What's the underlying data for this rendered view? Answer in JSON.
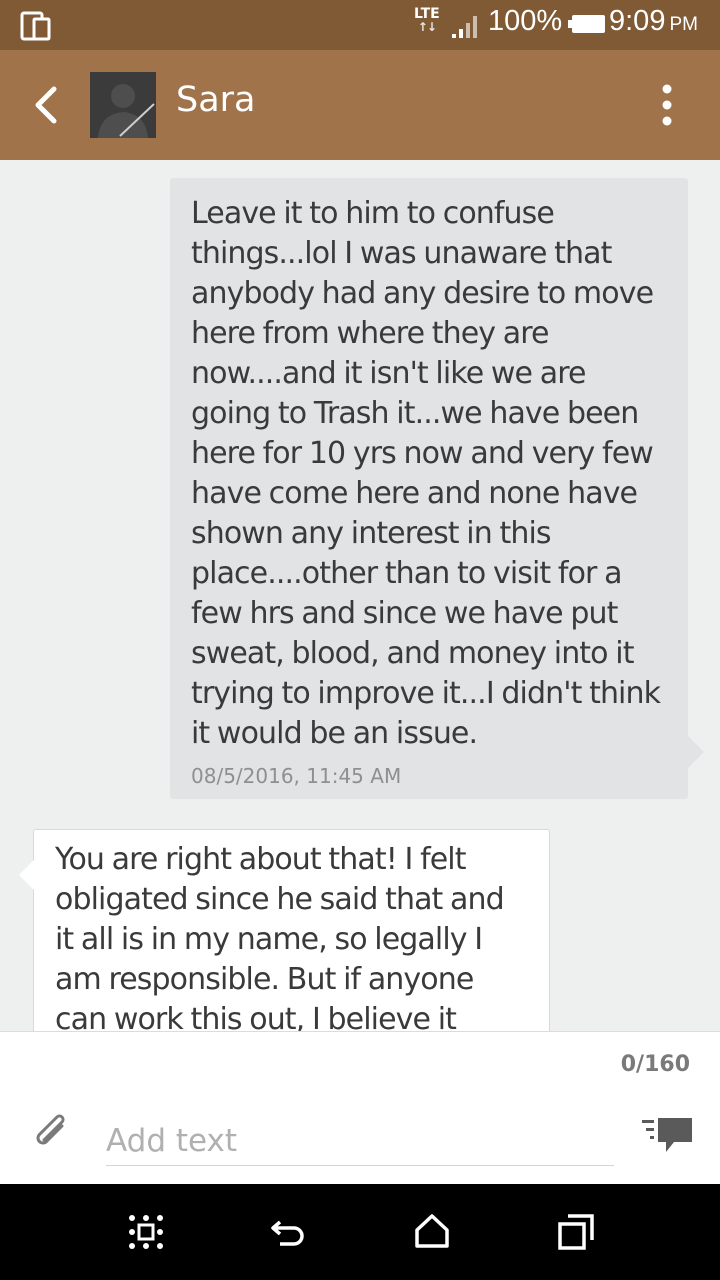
{
  "status_bar": {
    "network": "LTE",
    "battery": "100%",
    "time": "9:09",
    "ampm": "PM"
  },
  "header": {
    "contact_name": "Sara"
  },
  "messages": [
    {
      "direction": "outgoing",
      "text": "Leave it to him to confuse things...lol I was unaware that anybody had any desire to move here from where they are now....and it isn't like we are going to Trash it...we have been here for 10 yrs now and very few have come here and none have shown any interest in this place....other than to visit for a few hrs and since we have put sweat, blood, and money into it trying to improve it...I didn't think it would be an issue.",
      "timestamp": "08/5/2016, 11:45 AM"
    },
    {
      "direction": "incoming",
      "text": "You are right about that! I felt obligated since he said that and it all is in my name, so legally I am responsible.   But if anyone can work this out, I believe it"
    }
  ],
  "composer": {
    "char_count": "0/160",
    "placeholder": "Add text"
  },
  "colors": {
    "status_bar": "#7f5a35",
    "header": "#a0734b",
    "background": "#eef0ef",
    "outgoing_bubble": "#e1e3e5",
    "incoming_bubble": "#ffffff"
  }
}
